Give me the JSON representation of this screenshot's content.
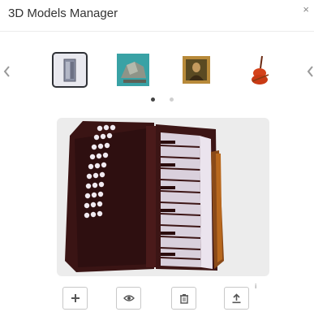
{
  "header": {
    "title": "3D Models Manager",
    "close_label": "×"
  },
  "carousel": {
    "models": [
      {
        "icon": "cabinet-icon",
        "selected": true
      },
      {
        "icon": "rock-icon",
        "selected": false
      },
      {
        "icon": "painting-icon",
        "selected": false
      },
      {
        "icon": "violin-icon",
        "selected": false
      }
    ],
    "pages": 2,
    "current_page": 1
  },
  "viewer": {
    "model_icon": "accordion-icon"
  },
  "toolbar": {
    "buttons": [
      {
        "icon": "plus-icon"
      },
      {
        "icon": "eye-icon"
      },
      {
        "icon": "trash-icon"
      },
      {
        "icon": "upload-icon"
      }
    ],
    "info_label": "i"
  },
  "colors": {
    "viewer_bg": "#ececec",
    "accordion_body": "#3a1414",
    "keys": "#e8e2ea",
    "accent_dark": "#2f3136"
  }
}
